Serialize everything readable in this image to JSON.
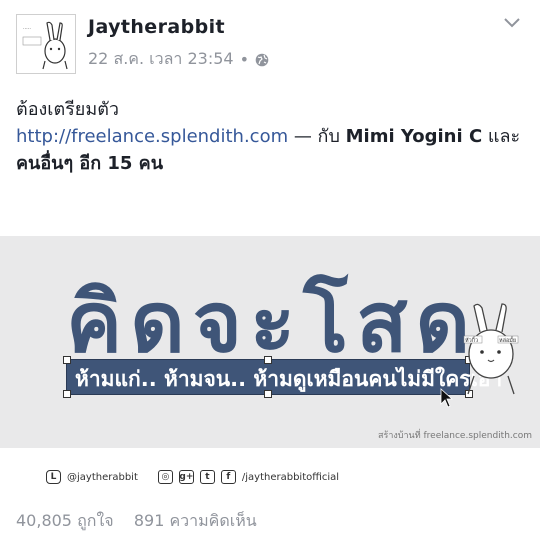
{
  "post": {
    "author": "Jaytherabbit",
    "timestamp": "22 ส.ค. เวลา 23:54",
    "text_line1": "ต้องเตรียมตัว",
    "link": "http://freelance.splendith.com",
    "dash": " — กับ ",
    "tagged_name": "Mimi Yogini C",
    "and": " และ",
    "others": "คนอื่นๆ อีก 15 คน"
  },
  "banner": {
    "headline": "คิดจะโสด",
    "subline": "ห้ามแก่.. ห้ามจน.. ห้ามดูเหมือนคนไม่มีใครเอา",
    "credit": "สร้างบ้านที่ freelance.splendith.com",
    "rabbit_text_left": "หัวกิ้ว",
    "rabbit_text_right": "หล่อมั้ย"
  },
  "social": {
    "line_handle": "@jaytherabbit",
    "facebook_handle": "/jaytherabbitofficial"
  },
  "stats": {
    "likes": "40,805 ถูกใจ",
    "comments": "891 ความคิดเห็น"
  }
}
